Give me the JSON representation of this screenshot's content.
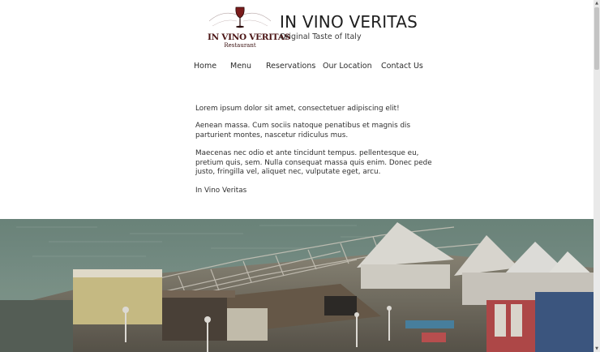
{
  "logo": {
    "line1": "IN VINO VERITAS",
    "line2": "Restaurant",
    "icon": "wine-glass-icon"
  },
  "header": {
    "title": "IN VINO VERITAS",
    "tagline": "Original Taste of Italy"
  },
  "nav": {
    "items": [
      "Home",
      "Menu",
      "Reservations",
      "Our Location",
      "Contact Us"
    ]
  },
  "content": {
    "p1": "Lorem ipsum dolor sit amet, consectetuer adipiscing elit!",
    "p2": "Aenean massa. Cum sociis natoque penatibus et magnis dis parturient montes, nascetur ridiculus mus.",
    "p3": "Maecenas nec odio et ante tincidunt tempus. pellentesque eu, pretium quis, sem. Nulla consequat massa quis enim. Donec pede justo, fringilla vel, aliquet nec, vulputate eget, arcu.",
    "p4": "In Vino Veritas"
  },
  "colors": {
    "logo_red": "#8b1a1a",
    "text": "#2b2b2b",
    "background": "#ffffff"
  },
  "scrollbar": {
    "up_icon": "scroll-up-arrow-icon",
    "down_icon": "scroll-down-arrow-icon"
  }
}
